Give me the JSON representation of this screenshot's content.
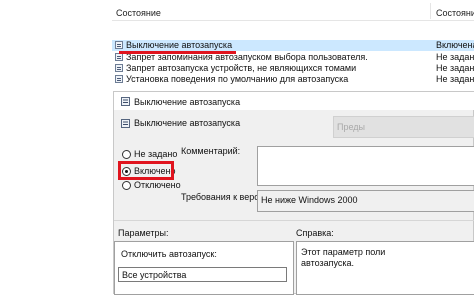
{
  "list": {
    "header": {
      "col_state": "Состояние",
      "col_state2": "Состояние"
    },
    "rows": [
      {
        "name": "Выключение автозапуска",
        "state": "Включена"
      },
      {
        "name": "Запрет запоминания автозапуском выбора пользователя.",
        "state": "Не задана"
      },
      {
        "name": "Запрет автозапуска устройств, не являющихся томами",
        "state": "Не задана"
      },
      {
        "name": "Установка поведения по умолчанию для автозапуска",
        "state": "Не задана"
      }
    ]
  },
  "dialog": {
    "title": "Выключение автозапуска",
    "policy_name": "Выключение автозапуска",
    "prev_button": "Преды",
    "radios": {
      "not_configured": "Не задано",
      "enabled": "Включено",
      "disabled": "Отключено"
    },
    "comment_label": "Комментарий:",
    "requirements_label": "Требования к версии:",
    "requirements_value": "Не ниже Windows 2000",
    "params_label": "Параметры:",
    "help_label": "Справка:",
    "params": {
      "disable_label": "Отключить автозапуск:",
      "dropdown_value": "Все устройства"
    },
    "help_text_line1": "Этот параметр поли",
    "help_text_line2": "автозапуска."
  }
}
